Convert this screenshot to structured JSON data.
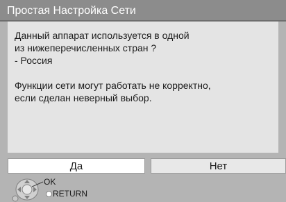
{
  "dialog": {
    "title": "Простая Настройка Сети",
    "lines": [
      "Данный аппарат используется в одной",
      "из нижеперечисленных стран ?",
      "- Россия",
      "Функции сети могут работать не корректно,",
      "если сделан неверный выбор."
    ]
  },
  "buttons": {
    "yes_label": "Да",
    "no_label": "Нет",
    "selected": "yes"
  },
  "footer": {
    "ok_label": "OK",
    "return_label": "RETURN",
    "icons": [
      "remote-navigation-icon",
      "return-button-icon"
    ]
  },
  "colors": {
    "title_bar": "#8c8c8c",
    "panel_background": "#b4b4b4",
    "dialog_background": "#e4e4e4",
    "selected_button": "#ffffff"
  }
}
